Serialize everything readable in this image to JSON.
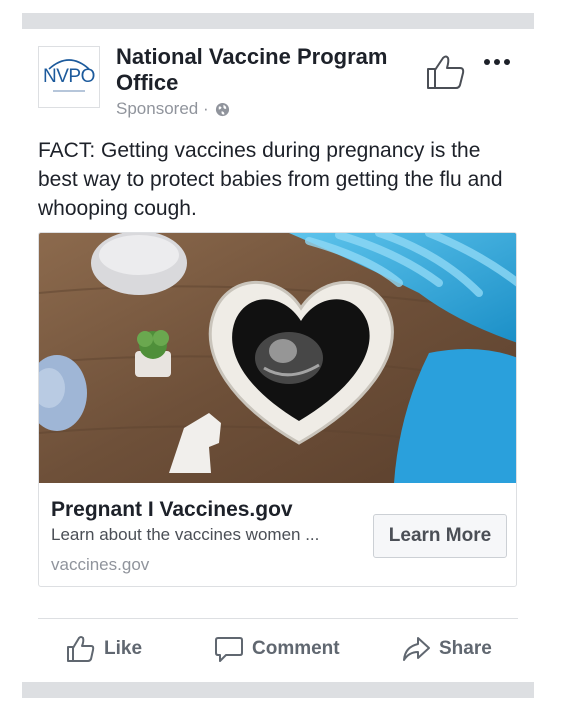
{
  "post": {
    "page_name": "National Vaccine Program Office",
    "logo_text": "NVPO",
    "sponsored_label": "Sponsored ·",
    "text": "FACT: Getting vaccines during pregnancy is the best way to protect babies from getting the flu and whooping cough."
  },
  "card": {
    "title": "Pregnant I Vaccines.gov",
    "description": "Learn about the vaccines women ...",
    "domain": "vaccines.gov",
    "button_label": "Learn More"
  },
  "actions": {
    "like": "Like",
    "comment": "Comment",
    "share": "Share"
  },
  "icons": {
    "globe": "globe-icon",
    "like_top": "thumbs-up-icon",
    "more": "more-options-icon",
    "like": "thumbs-up-icon",
    "comment": "comment-icon",
    "share": "share-icon"
  },
  "colors": {
    "text": "#1d2129",
    "muted": "#90949c",
    "action": "#606770",
    "border": "#dddfe2",
    "logo_blue": "#1c5a9c"
  }
}
